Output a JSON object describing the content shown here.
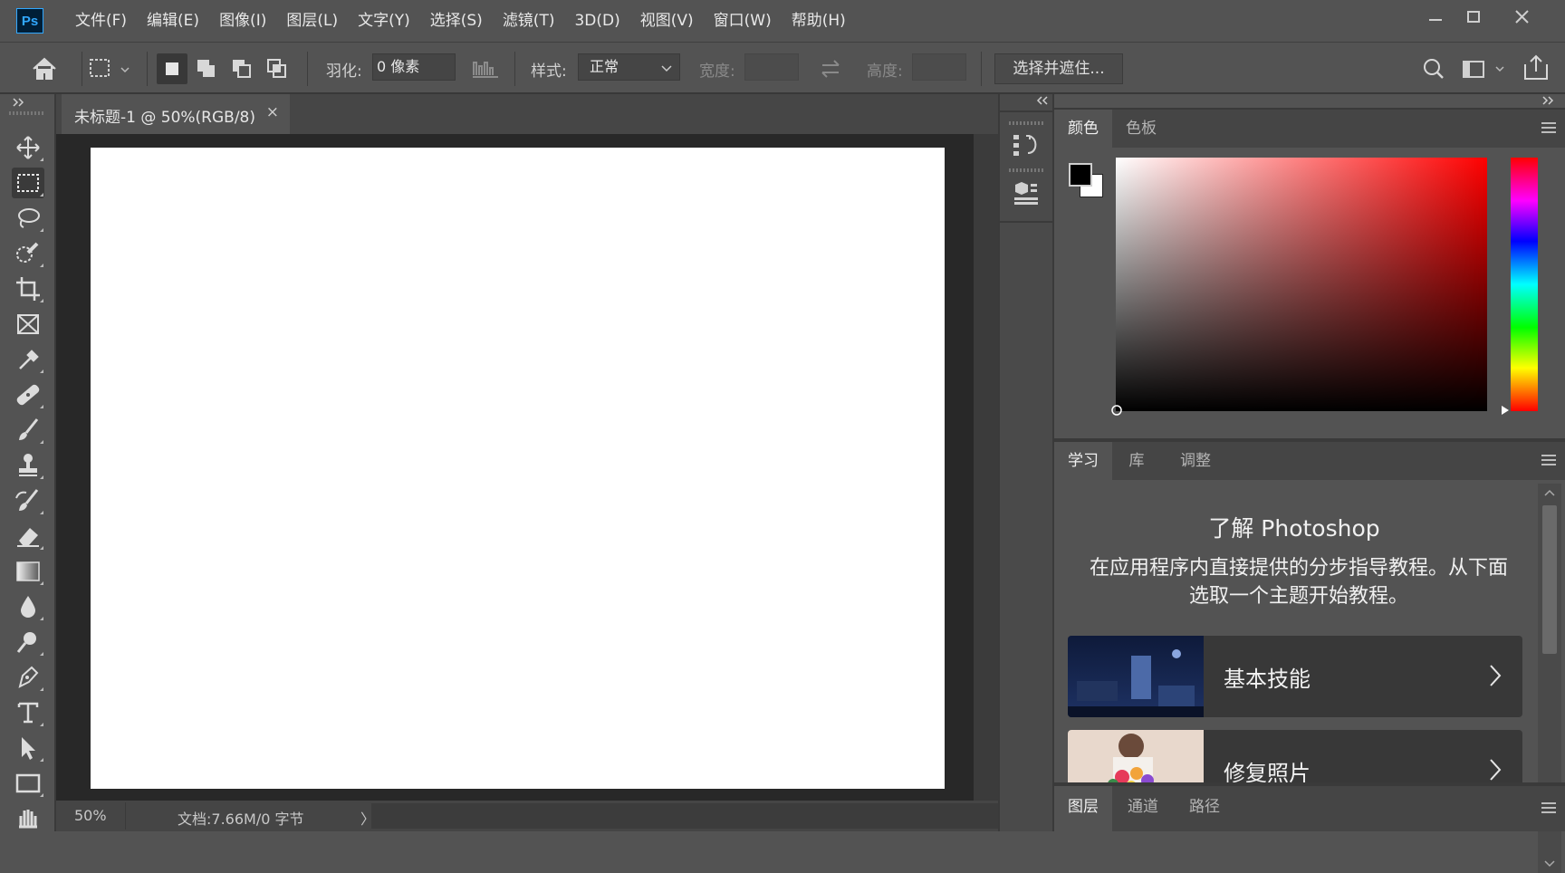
{
  "app": {
    "logo_text": "Ps"
  },
  "menu": [
    {
      "label": "文件(F)"
    },
    {
      "label": "编辑(E)"
    },
    {
      "label": "图像(I)"
    },
    {
      "label": "图层(L)"
    },
    {
      "label": "文字(Y)"
    },
    {
      "label": "选择(S)"
    },
    {
      "label": "滤镜(T)"
    },
    {
      "label": "3D(D)"
    },
    {
      "label": "视图(V)"
    },
    {
      "label": "窗口(W)"
    },
    {
      "label": "帮助(H)"
    }
  ],
  "options": {
    "feather_label": "羽化:",
    "feather_value": "0 像素",
    "style_label": "样式:",
    "style_value": "正常",
    "width_label": "宽度:",
    "height_label": "高度:",
    "select_mask_label": "选择并遮住..."
  },
  "document": {
    "tab_title": "未标题-1 @ 50%(RGB/8)",
    "close_glyph": "×",
    "zoom": "50%",
    "doc_info": "文档:7.66M/0 字节",
    "status_arrow": "〉"
  },
  "panels": {
    "color_tabs": [
      "颜色",
      "色板"
    ],
    "learn_tabs": [
      "学习",
      "库",
      "调整"
    ],
    "layer_tabs": [
      "图层",
      "通道",
      "路径"
    ],
    "foreground_color": "#000000",
    "background_color": "#ffffff",
    "hue_color": "#ff0000"
  },
  "learn": {
    "title": "了解 Photoshop",
    "description": "在应用程序内直接提供的分步指导教程。从下面选取一个主题开始教程。",
    "cards": [
      {
        "label": "基本技能"
      },
      {
        "label": "修复照片"
      }
    ]
  },
  "colors": {
    "chrome": "#535353",
    "dark": "#383838",
    "workspace": "#282828",
    "canvas": "#ffffff"
  }
}
